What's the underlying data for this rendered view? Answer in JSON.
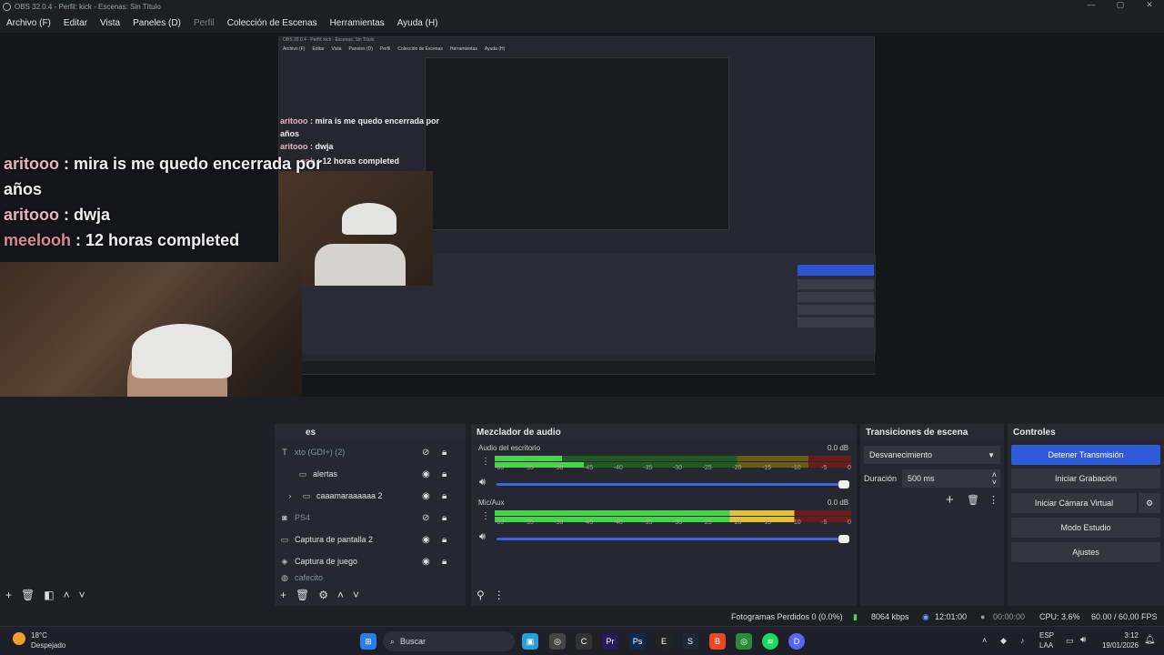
{
  "window": {
    "title": "OBS 32.0.4 - Perfil: kick - Escenas: Sin Título",
    "controls": [
      "—",
      "▢",
      "✕"
    ]
  },
  "menu": [
    {
      "label": "Archivo (F)",
      "enabled": true
    },
    {
      "label": "Editar",
      "enabled": true
    },
    {
      "label": "Vista",
      "enabled": true
    },
    {
      "label": "Paneles (D)",
      "enabled": true
    },
    {
      "label": "Perfil",
      "enabled": false
    },
    {
      "label": "Colección de Escenas",
      "enabled": true
    },
    {
      "label": "Herramientas",
      "enabled": true
    },
    {
      "label": "Ayuda (H)",
      "enabled": true
    }
  ],
  "chat": [
    {
      "user": "aritooo",
      "message": "mira is me quedo encerrada por",
      "cont": "años"
    },
    {
      "user": "aritooo",
      "message": "dwja"
    },
    {
      "user": "meelooh",
      "message": "12 horas completed"
    }
  ],
  "chat_small": [
    {
      "user": "aritooo",
      "message": "mira is me quedo encerrada por",
      "cont": "años"
    },
    {
      "user": "aritooo",
      "message": "dwja"
    },
    {
      "user": "ooh",
      "message": "12 horas completed"
    }
  ],
  "docks": {
    "sources_title": "es",
    "mixer_title": "Mezclador de audio",
    "transitions_title": "Transiciones de escena",
    "controls_title": "Controles"
  },
  "sources": [
    {
      "label": "xto (GDI+) (2)",
      "icon": "text-icon",
      "visible": false,
      "dim": true
    },
    {
      "label": "alertas",
      "icon": "folder-icon",
      "visible": true,
      "dim": false
    },
    {
      "label": "caaamaraaaaaa 2",
      "icon": "folder-icon",
      "visible": true,
      "dim": false
    },
    {
      "label": "PS4",
      "icon": "camera-icon",
      "visible": false,
      "dim": true
    },
    {
      "label": "Captura de pantalla 2",
      "icon": "monitor-icon",
      "visible": true,
      "dim": false
    },
    {
      "label": "Captura de juego",
      "icon": "gamepad-icon",
      "visible": true,
      "dim": false
    },
    {
      "label": "cafecito",
      "icon": "globe-icon",
      "visible": true,
      "dim": true
    }
  ],
  "mixer": {
    "channels": [
      {
        "name": "Audio del escritorio",
        "db": "0.0 dB",
        "level": 0.25
      },
      {
        "name": "Mic/Aux",
        "db": "0.0 dB",
        "level": 1.0
      }
    ],
    "scale": [
      "-60",
      "-55",
      "-50",
      "-45",
      "-40",
      "-35",
      "-30",
      "-25",
      "-20",
      "-15",
      "-10",
      "-5",
      "0"
    ]
  },
  "transitions": {
    "selected": "Desvanecimiento",
    "duration_label": "Duración",
    "duration_value": "500 ms"
  },
  "controls": {
    "stop_stream": "Detener Transmisión",
    "start_recording": "Iniciar Grabación",
    "start_virtual_cam": "Iniciar Cámara Virtual",
    "studio_mode": "Modo Estudio",
    "settings": "Ajustes"
  },
  "status": {
    "dropped_frames": "Fotogramas Perdidos 0 (0.0%)",
    "bitrate": "8064 kbps",
    "stream_time": "12:01:00",
    "rec_time": "00:00:00",
    "cpu": "CPU: 3.6%",
    "fps": "60.00 / 60.00 FPS"
  },
  "taskbar": {
    "temp": "18°C",
    "weather": "Despejado",
    "search": "Buscar",
    "lang": "ESP",
    "region": "LAA",
    "time": "3:12",
    "date": "19/01/2026"
  },
  "colors": {
    "accent": "#2f5bd9",
    "meter_green": "#49d24b",
    "meter_yellow": "#e3c23b",
    "meter_red": "#c0392b"
  }
}
